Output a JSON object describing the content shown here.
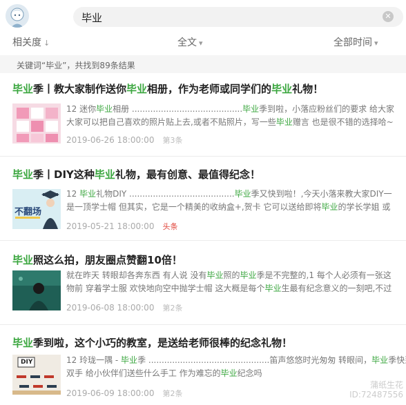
{
  "search": {
    "query": "毕业"
  },
  "filters": {
    "relevance": "相关度",
    "fulltext": "全文",
    "alltime": "全部时间"
  },
  "summary": "关键词“毕业”，共找到89条结果",
  "results": [
    {
      "title_kw1": "毕业",
      "title_a": "季丨教大家制作送你",
      "title_kw2": "毕业",
      "title_b": "相册，作为老师或同学们的",
      "title_kw3": "毕业",
      "title_c": "礼物！",
      "s1_a": "12 迷你",
      "s1_kw": "毕业",
      "s1_b": "相册 ..........................................",
      "s1_kw2": "毕业",
      "s1_c": "季到啦，小落应粉丝们的要求 给大家",
      "s2_a": "大家可以把自己喜欢的照片贴上去,或者不贴照片，写一些",
      "s2_kw": "毕业",
      "s2_b": "赠言 也是很不错的选择哈~",
      "date": "2019-06-26 18:00:00",
      "source": "第3条"
    },
    {
      "title_kw1": "毕业",
      "title_a": "季丨DIY这种",
      "title_kw2": "毕业",
      "title_b": "礼物，最有创意、最值得纪念！",
      "s1_a": "12 ",
      "s1_kw": "毕业",
      "s1_b": "礼物DIY ........................................",
      "s1_kw2": "毕业",
      "s1_c": "季又快到啦！,今天小落来教大家DIY一",
      "s2_a": "是一顶学士帽 但其实，它是一个精美的收纳盒+,贺卡 它可以送给即将",
      "s2_kw": "毕业",
      "s2_b": "的学长学姐 或",
      "date": "2019-05-21 18:00:00",
      "source": "头条",
      "thumb_text": "不翻场"
    },
    {
      "title_kw1": "毕业",
      "title_a": "照这么拍，朋友圈点赞翻10倍！",
      "s1_a": "就在昨天 转眼却各奔东西 有人说 没有",
      "s1_kw": "毕业",
      "s1_b": "照的",
      "s1_kw2": "毕业",
      "s1_c": "季是不完整的,1 每个人必须有一张这",
      "s2_a": "物前 穿着学士服 欢快地向空中抛学士帽 这大概是每个",
      "s2_kw": "毕业",
      "s2_b": "生最有纪念意义的一刻吧,不过",
      "date": "2019-06-08 18:00:00",
      "source": "第2条"
    },
    {
      "title_kw1": "毕业",
      "title_a": "季到啦，这个小巧的教室，是送给老师很棒的纪念礼物！",
      "s1_a": "12 玲珑一隅 - ",
      "s1_kw": "毕业",
      "s1_b": "季 ..............................................笛声悠悠时光匆匆 转眼间，",
      "s1_kw2": "毕业",
      "s1_c": "季快到",
      "s2_a": "双手 给小伙伴们送些什么手工 作为难忘的",
      "s2_kw": "毕业",
      "s2_b": "纪念吗",
      "date": "2019-06-09 18:00:00",
      "source": "第2条",
      "thumb_text": "DIY"
    }
  ],
  "watermark": {
    "line1": "蒲纸生花",
    "line2": "ID:72487556"
  },
  "colors": {
    "keyword": "#3aa63e",
    "summary_bg": "#f5f5f5",
    "search_bg": "#f2f2f2"
  }
}
